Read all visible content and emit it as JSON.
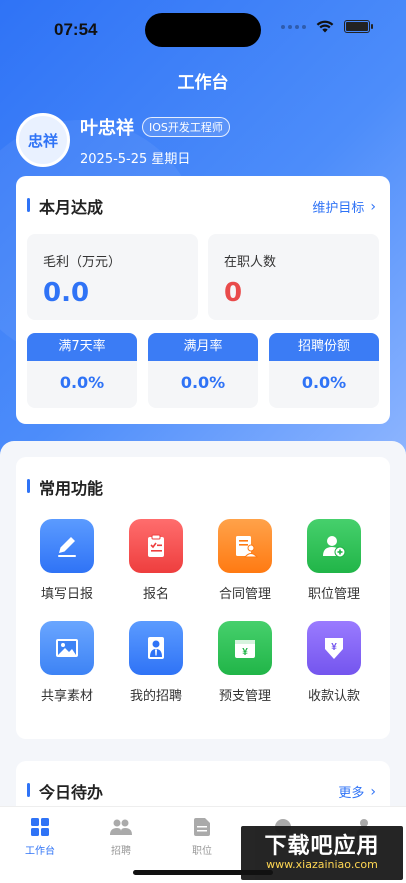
{
  "status_bar": {
    "time": "07:54"
  },
  "header": {
    "title": "工作台"
  },
  "user": {
    "avatar_text": "忠祥",
    "name": "叶忠祥",
    "role": "IOS开发工程师",
    "date": "2025-5-25 星期日"
  },
  "achievement": {
    "title": "本月达成",
    "link_label": "维护目标",
    "gross_profit": {
      "label": "毛利（万元）",
      "value": "0.0"
    },
    "staff_count": {
      "label": "在职人数",
      "value": "0"
    },
    "rates": [
      {
        "label": "满7天率",
        "value": "0.0%"
      },
      {
        "label": "满月率",
        "value": "0.0%"
      },
      {
        "label": "招聘份额",
        "value": "0.0%"
      }
    ]
  },
  "functions": {
    "title": "常用功能",
    "items": [
      {
        "label": "填写日报",
        "icon": "pencil-icon",
        "color": "#3d83f5"
      },
      {
        "label": "报名",
        "icon": "clipboard-icon",
        "color": "#f04b4b"
      },
      {
        "label": "合同管理",
        "icon": "contract-icon",
        "color": "#ff8a1f"
      },
      {
        "label": "职位管理",
        "icon": "add-user-icon",
        "color": "#2cc355"
      },
      {
        "label": "共享素材",
        "icon": "image-icon",
        "color": "#3d83f5"
      },
      {
        "label": "我的招聘",
        "icon": "person-tie-icon",
        "color": "#3d83f5"
      },
      {
        "label": "预支管理",
        "icon": "cash-icon",
        "color": "#2cc355"
      },
      {
        "label": "收款认款",
        "icon": "receive-money-icon",
        "color": "#7a5cf0"
      }
    ]
  },
  "todo": {
    "title": "今日待办",
    "link_label": "更多"
  },
  "tabbar": {
    "items": [
      {
        "label": "工作台",
        "icon": "grid-icon",
        "active": true
      },
      {
        "label": "招聘",
        "icon": "group-icon",
        "active": false
      },
      {
        "label": "职位",
        "icon": "document-icon",
        "active": false
      },
      {
        "label": "",
        "icon": "message-icon",
        "active": false
      },
      {
        "label": "",
        "icon": "profile-icon",
        "active": false
      }
    ]
  },
  "watermark": {
    "main": "下载吧应用",
    "sub": "www.xiazainiao.com"
  },
  "colors": {
    "accent": "#2f73f6",
    "profit": "#2f73f6",
    "staff": "#e94b4b"
  }
}
